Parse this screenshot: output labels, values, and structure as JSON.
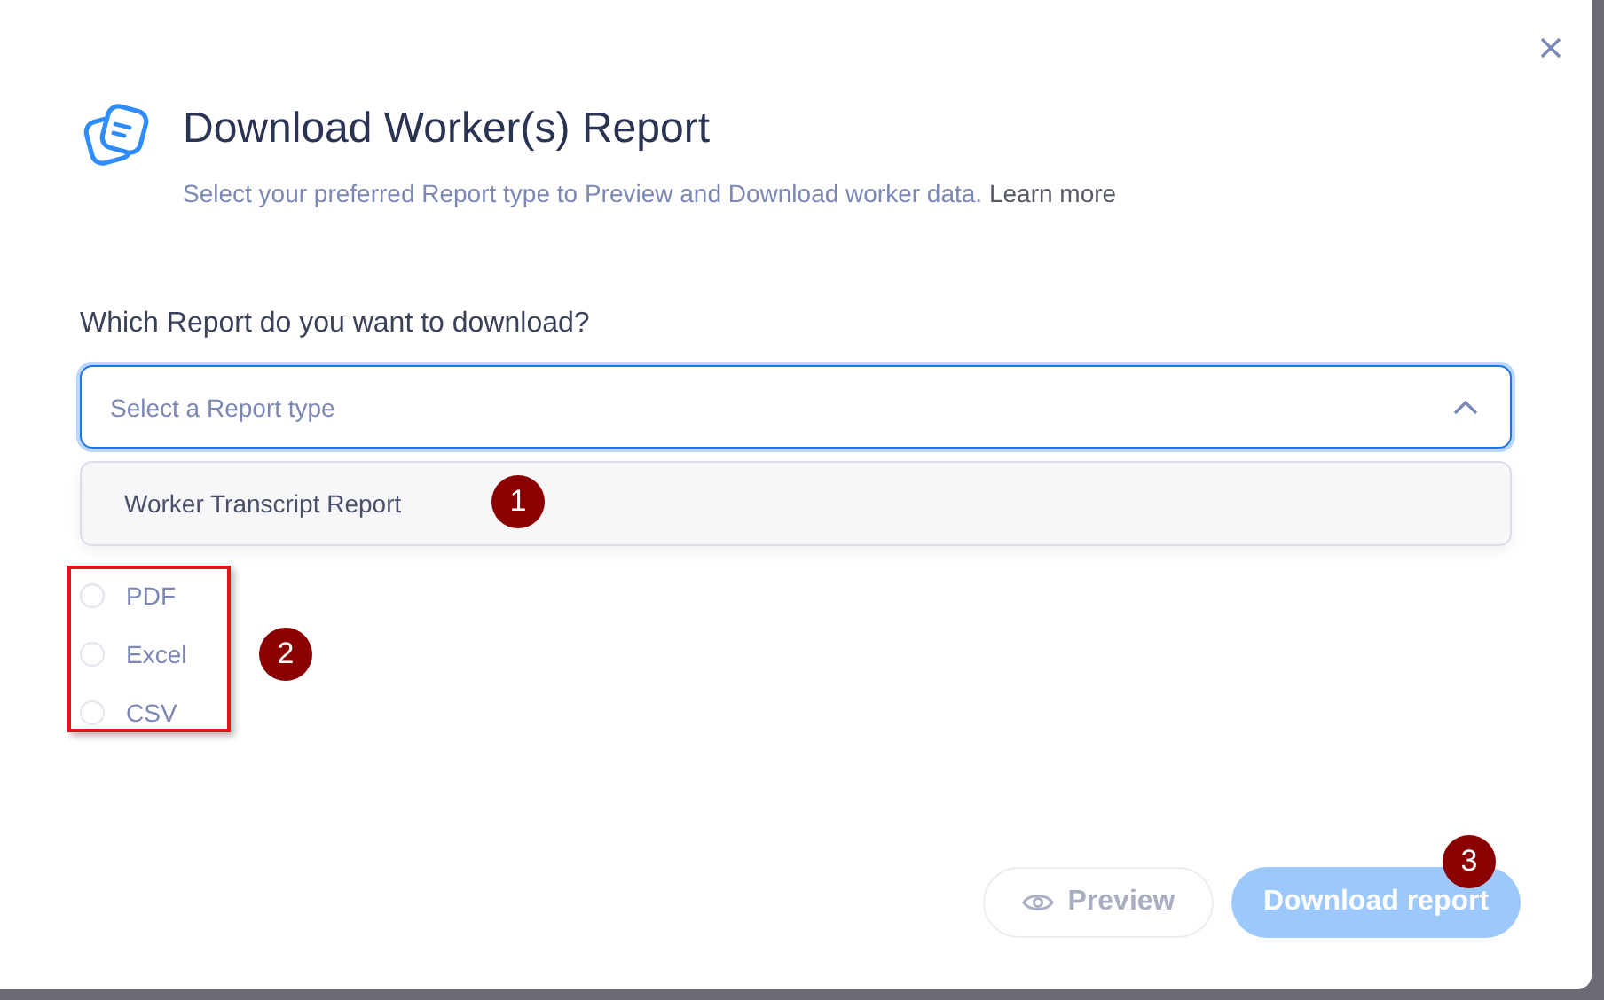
{
  "dialog": {
    "title": "Download Worker(s) Report",
    "subtitle": "Select your preferred Report type to Preview and Download worker data.",
    "learn_more": "Learn more"
  },
  "question": "Which Report do you want to download?",
  "select": {
    "placeholder": "Select a Report type",
    "expanded": true,
    "options": [
      "Worker Transcript Report"
    ]
  },
  "formats": [
    {
      "label": "PDF",
      "selected": false
    },
    {
      "label": "Excel",
      "selected": false
    },
    {
      "label": "CSV",
      "selected": false
    }
  ],
  "buttons": [
    {
      "label": "Preview",
      "kind": "secondary",
      "disabled": true
    },
    {
      "label": "Download report",
      "kind": "primary",
      "disabled": true
    }
  ],
  "annotations": [
    "1",
    "2",
    "3"
  ]
}
